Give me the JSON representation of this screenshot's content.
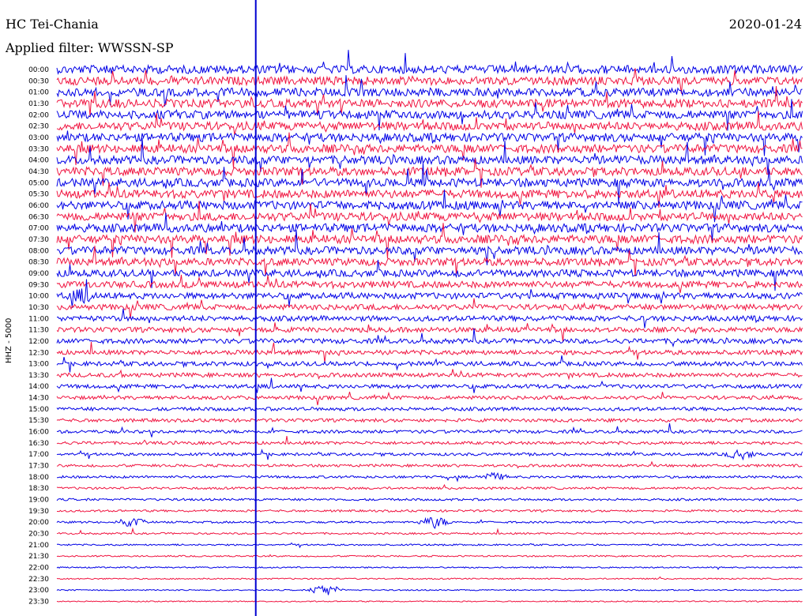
{
  "header": {
    "station": "HC Tei-Chania",
    "date": "2020-01-24",
    "filter": "Applied filter: WWSSN-SP"
  },
  "chart_data": {
    "type": "line",
    "title": "HC Tei-Chania",
    "ylabel": "HHZ - 5000",
    "y_tick_labels": [
      "00:00",
      "00:30",
      "01:00",
      "01:30",
      "02:00",
      "02:30",
      "03:00",
      "03:30",
      "04:00",
      "04:30",
      "05:00",
      "05:30",
      "06:00",
      "06:30",
      "07:00",
      "07:30",
      "08:00",
      "08:30",
      "09:00",
      "09:30",
      "10:00",
      "10:30",
      "11:00",
      "11:30",
      "12:00",
      "12:30",
      "13:00",
      "13:30",
      "14:00",
      "14:30",
      "15:00",
      "15:30",
      "16:00",
      "16:30",
      "17:00",
      "17:30",
      "18:00",
      "18:30",
      "19:00",
      "19:30",
      "20:00",
      "20:30",
      "21:00",
      "21:30",
      "22:00",
      "22:30",
      "23:00",
      "23:30"
    ],
    "trace_colors": [
      "#0000e6",
      "#f01440"
    ],
    "marker_color": "#0000d0",
    "current_time_marker_minute": 8,
    "row_duration_minutes": 30,
    "row_noise_level": [
      0.95,
      0.95,
      0.95,
      0.95,
      0.95,
      0.95,
      0.95,
      0.95,
      0.95,
      0.95,
      0.95,
      0.95,
      0.95,
      0.95,
      0.95,
      0.95,
      0.9,
      0.85,
      0.8,
      0.75,
      0.7,
      0.65,
      0.6,
      0.58,
      0.55,
      0.52,
      0.5,
      0.48,
      0.45,
      0.42,
      0.4,
      0.38,
      0.36,
      0.34,
      0.32,
      0.3,
      0.28,
      0.26,
      0.25,
      0.24,
      0.22,
      0.2,
      0.18,
      0.17,
      0.16,
      0.15,
      0.14,
      0.13
    ],
    "events": [
      {
        "row": 20,
        "minute": 1.0,
        "amplitude": 0.7
      },
      {
        "row": 36,
        "minute": 17.5,
        "amplitude": 0.5
      },
      {
        "row": 40,
        "minute": 3.0,
        "amplitude": 0.6
      },
      {
        "row": 40,
        "minute": 15.2,
        "amplitude": 0.8
      },
      {
        "row": 46,
        "minute": 10.8,
        "amplitude": 0.9
      },
      {
        "row": 34,
        "minute": 27.5,
        "amplitude": 0.6
      }
    ]
  }
}
